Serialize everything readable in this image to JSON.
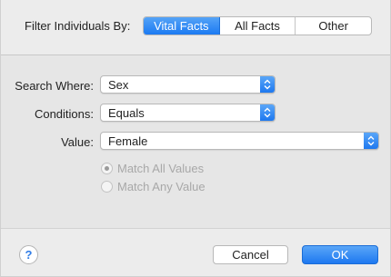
{
  "filter": {
    "label": "Filter Individuals By:",
    "segments": [
      "Vital Facts",
      "All Facts",
      "Other"
    ],
    "active_index": 0
  },
  "fields": {
    "search_where": {
      "label": "Search Where:",
      "value": "Sex"
    },
    "conditions": {
      "label": "Conditions:",
      "value": "Equals"
    },
    "value": {
      "label": "Value:",
      "value": "Female"
    }
  },
  "match_options": {
    "all": "Match All Values",
    "any": "Match Any Value",
    "selected": "all",
    "enabled": false
  },
  "footer": {
    "help": "?",
    "cancel": "Cancel",
    "ok": "OK"
  },
  "colors": {
    "accent": "#1c7af2",
    "background": "#ececec",
    "disabled_text": "#a8a8a8"
  },
  "icons": {
    "stepper": "up-down-chevron-icon",
    "help": "question-mark-icon"
  }
}
